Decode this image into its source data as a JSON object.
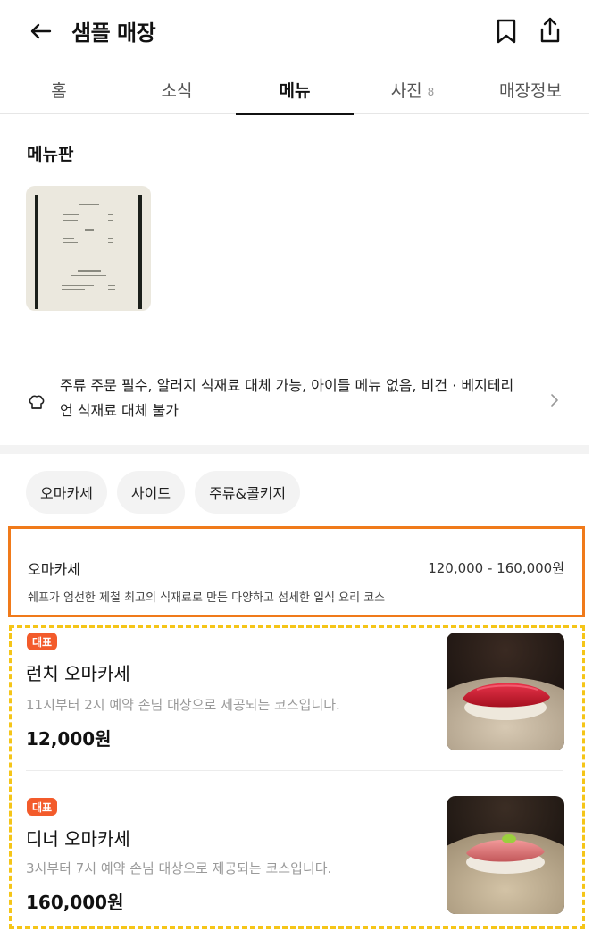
{
  "header": {
    "title": "샘플 매장",
    "back_icon": "arrow-left-icon",
    "bookmark_icon": "bookmark-icon",
    "share_icon": "share-icon"
  },
  "tabs": [
    {
      "label": "홈",
      "count": ""
    },
    {
      "label": "소식",
      "count": ""
    },
    {
      "label": "메뉴",
      "count": "",
      "active": true
    },
    {
      "label": "사진",
      "count": "8"
    },
    {
      "label": "매장정보",
      "count": ""
    }
  ],
  "menuboard": {
    "title": "메뉴판",
    "thumbnail_icon": "menu-board-image"
  },
  "notice": {
    "icon": "chef-hat-icon",
    "text": "주류 주문 필수, 알러지 식재료 대체 가능, 아이들 메뉴 없음, 비건 · 베지테리언 식재료 대체 불가"
  },
  "chips": [
    "오마카세",
    "사이드",
    "주류&콜키지"
  ],
  "category": {
    "name": "오마카세",
    "price_range": "120,000 - 160,000원",
    "description": "쉐프가 엄선한 제철 최고의 식재료로 만든 다양하고 섬세한 일식 요리 코스"
  },
  "items": [
    {
      "badge": "대표",
      "name": "런치 오마카세",
      "description": "11시부터 2시 예약 손님 대상으로 제공되는 코스입니다.",
      "price": "12,000원",
      "photo": "tuna-nigiri-photo"
    },
    {
      "badge": "대표",
      "name": "디너 오마카세",
      "description": "3시부터 7시 예약 손님 대상으로 제공되는 코스입니다.",
      "price": "160,000원",
      "photo": "seared-nigiri-photo"
    }
  ],
  "colors": {
    "badge": "#f35b2b",
    "category_outline": "#f07a1a",
    "items_outline": "#f5c518"
  }
}
